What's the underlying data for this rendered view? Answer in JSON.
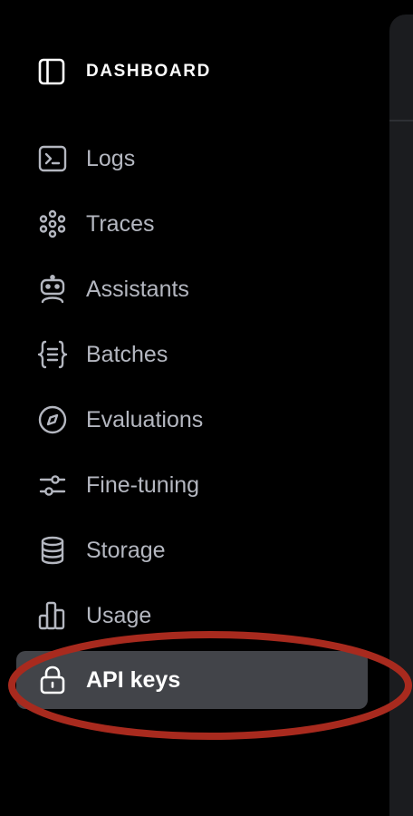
{
  "sidebar": {
    "title": "DASHBOARD",
    "items": [
      {
        "label": "Logs",
        "icon": "terminal-icon"
      },
      {
        "label": "Traces",
        "icon": "traces-icon"
      },
      {
        "label": "Assistants",
        "icon": "robot-icon"
      },
      {
        "label": "Batches",
        "icon": "braces-icon"
      },
      {
        "label": "Evaluations",
        "icon": "compass-icon"
      },
      {
        "label": "Fine-tuning",
        "icon": "sliders-icon"
      },
      {
        "label": "Storage",
        "icon": "database-icon"
      },
      {
        "label": "Usage",
        "icon": "bar-chart-icon"
      },
      {
        "label": "API keys",
        "icon": "lock-icon",
        "active": true
      }
    ]
  },
  "colors": {
    "background": "#000000",
    "active_item_bg": "#424449",
    "inactive_text": "#b4b7c0",
    "active_text": "#ffffff",
    "annotation": "#a82a1e"
  }
}
